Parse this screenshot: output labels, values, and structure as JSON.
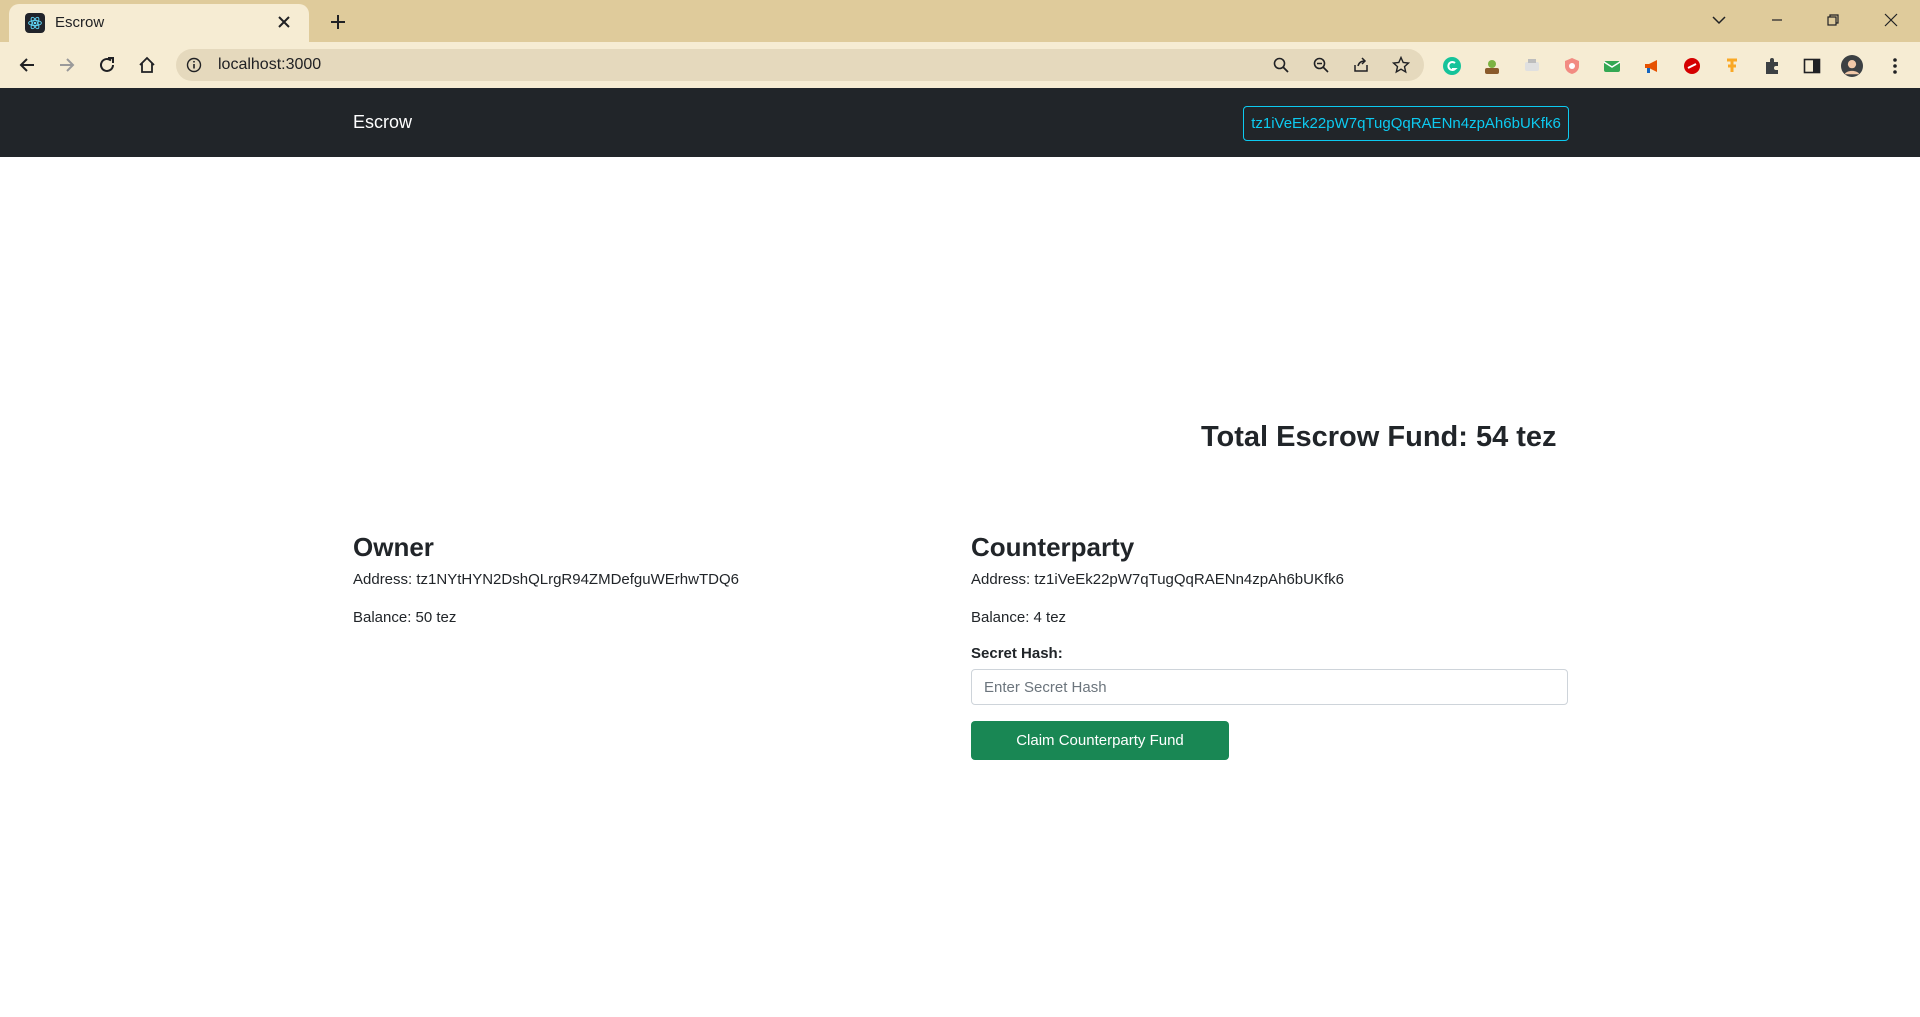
{
  "browser": {
    "tab_title": "Escrow",
    "url": "localhost:3000",
    "icons": [
      "react-favicon-icon",
      "close-icon",
      "plus-icon",
      "chevron-down-icon",
      "minimize-icon",
      "restore-icon",
      "window-close-icon",
      "back-arrow-icon",
      "forward-arrow-icon",
      "reload-icon",
      "home-icon",
      "info-icon",
      "search-icon",
      "zoom-out-icon",
      "share-icon",
      "star-icon",
      "puzzle-icon",
      "sidebar-icon",
      "avatar",
      "kebab-menu-icon"
    ]
  },
  "navbar": {
    "brand": "Escrow",
    "wallet_address": "tz1iVeEk22pW7qTugQqRAENn4zpAh6bUKfk6"
  },
  "total_fund": "Total Escrow Fund: 54 tez",
  "owner": {
    "title": "Owner",
    "address": "Address: tz1NYtHYN2DshQLrgR94ZMDefguWErhwTDQ6",
    "balance": "Balance: 50 tez"
  },
  "counterparty": {
    "title": "Counterparty",
    "address": "Address: tz1iVeEk22pW7qTugQqRAENn4zpAh6bUKfk6",
    "balance": "Balance: 4 tez",
    "secret_label": "Secret Hash:",
    "secret_placeholder": "Enter Secret Hash",
    "claim_button": "Claim Counterparty Fund"
  },
  "colors": {
    "navbar_bg": "#212529",
    "wallet_accent": "#0dcaf0",
    "claim_button_bg": "#198754",
    "chrome_frame": "#dfcb9b",
    "chrome_toolbar": "#f6ecd3"
  }
}
